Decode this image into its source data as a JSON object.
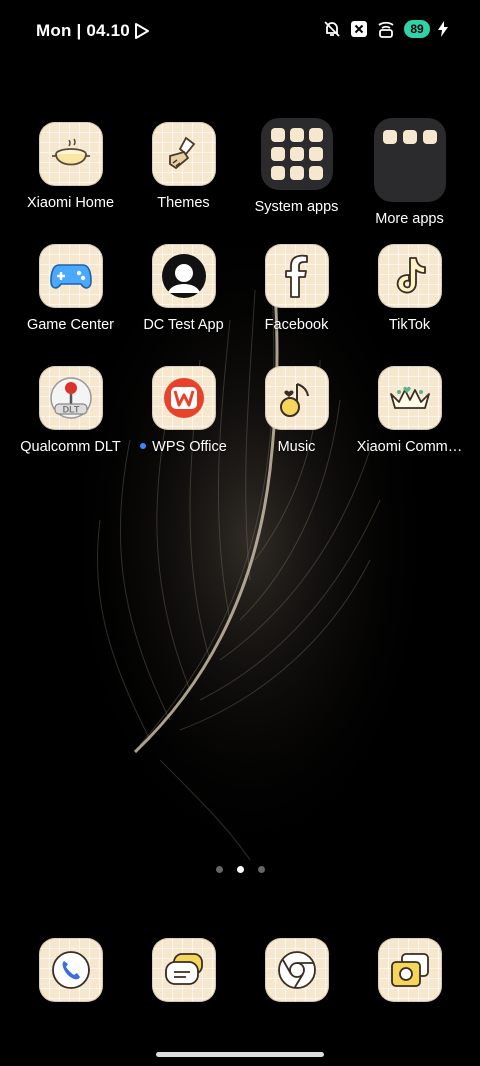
{
  "status": {
    "time": "Mon | 04.10",
    "battery": "89",
    "icons": [
      "play-icon",
      "mute-icon",
      "close-box-icon",
      "hotspot-icon",
      "battery-icon",
      "charging-icon"
    ]
  },
  "apps": [
    {
      "label": "Xiaomi Home",
      "icon": "pot-icon"
    },
    {
      "label": "Themes",
      "icon": "brush-icon"
    },
    {
      "label": "System apps",
      "icon": "folder-icon"
    },
    {
      "label": "More apps",
      "icon": "folder-icon"
    },
    {
      "label": "Game Center",
      "icon": "gamepad-icon"
    },
    {
      "label": "DC Test App",
      "icon": "person-icon"
    },
    {
      "label": "Facebook",
      "icon": "facebook-icon"
    },
    {
      "label": "TikTok",
      "icon": "tiktok-icon"
    },
    {
      "label": "Qualcomm DLT",
      "icon": "joystick-icon"
    },
    {
      "label": "WPS Office",
      "icon": "wps-icon",
      "new_badge": true
    },
    {
      "label": "Music",
      "icon": "music-note-icon"
    },
    {
      "label": "Xiaomi Comm…",
      "icon": "crown-icon"
    }
  ],
  "pager": {
    "pages": 3,
    "active": 2
  },
  "dock": [
    {
      "icon": "phone-icon"
    },
    {
      "icon": "messages-icon"
    },
    {
      "icon": "browser-icon"
    },
    {
      "icon": "gallery-icon"
    }
  ],
  "colors": {
    "tile": "#f6e7cf",
    "folder": "#2b2b2d",
    "battery": "#2ed3a8",
    "badge": "#3d86ff"
  }
}
